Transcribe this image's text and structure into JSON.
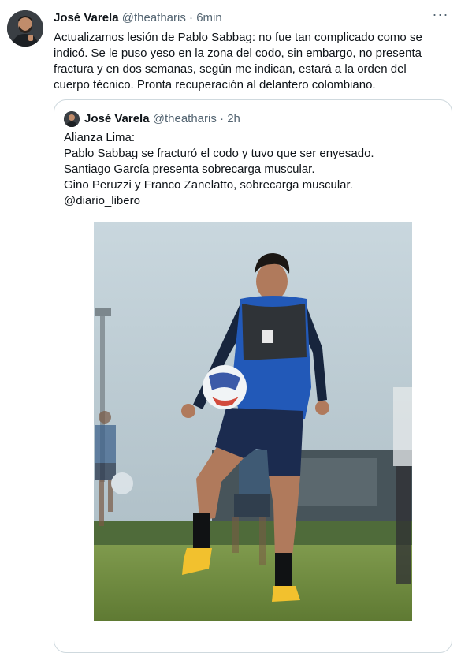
{
  "tweet": {
    "author_name": "José Varela",
    "handle": "@theatharis",
    "separator": "·",
    "time": "6min",
    "more_label": "···",
    "text": "Actualizamos lesión de Pablo Sabbag: no fue tan complicado como se indicó. Se le puso yeso en la zona del codo, sin embargo, no presenta fractura y en dos semanas, según me indican, estará a la orden del cuerpo técnico. Pronta recuperación al delantero colombiano."
  },
  "quoted": {
    "author_name": "José Varela",
    "handle": "@theatharis",
    "separator": "·",
    "time": "2h",
    "lines": [
      "Alianza Lima:",
      "Pablo Sabbag se fracturó el codo y tuvo que ser enyesado.",
      "Santiago García presenta sobrecarga muscular.",
      "Gino Peruzzi y Franco Zanelatto, sobrecarga muscular.",
      "@diario_libero"
    ]
  },
  "colors": {
    "text_primary": "#0f1419",
    "text_secondary": "#536471",
    "border": "#cfd9de"
  },
  "icons": [
    "more-options-icon",
    "avatar-image"
  ]
}
